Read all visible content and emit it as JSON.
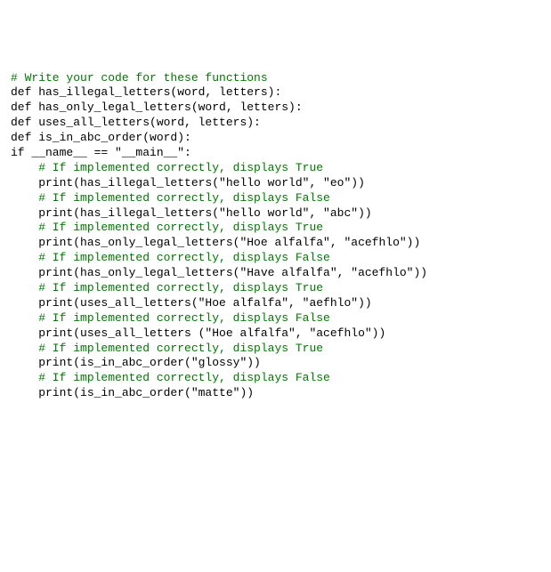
{
  "lines": [
    {
      "text": "# Write your code for these functions",
      "indent": 0,
      "style": "comment"
    },
    {
      "text": "def has_illegal_letters(word, letters):",
      "indent": 0,
      "style": "code"
    },
    {
      "text": "",
      "indent": 0,
      "style": "code"
    },
    {
      "text": "",
      "indent": 0,
      "style": "code"
    },
    {
      "text": "def has_only_legal_letters(word, letters):",
      "indent": 0,
      "style": "code"
    },
    {
      "text": "",
      "indent": 0,
      "style": "code"
    },
    {
      "text": "",
      "indent": 0,
      "style": "code"
    },
    {
      "text": "def uses_all_letters(word, letters):",
      "indent": 0,
      "style": "code"
    },
    {
      "text": "",
      "indent": 0,
      "style": "code"
    },
    {
      "text": "",
      "indent": 0,
      "style": "code"
    },
    {
      "text": "def is_in_abc_order(word):",
      "indent": 0,
      "style": "code"
    },
    {
      "text": "",
      "indent": 0,
      "style": "code"
    },
    {
      "text": "",
      "indent": 0,
      "style": "code"
    },
    {
      "text": "if __name__ == \"__main__\":",
      "indent": 0,
      "style": "code"
    },
    {
      "text": "# If implemented correctly, displays True",
      "indent": 4,
      "style": "comment"
    },
    {
      "text": "print(has_illegal_letters(\"hello world\", \"eo\"))",
      "indent": 4,
      "style": "code"
    },
    {
      "text": "",
      "indent": 0,
      "style": "code"
    },
    {
      "text": "# If implemented correctly, displays False",
      "indent": 4,
      "style": "comment"
    },
    {
      "text": "print(has_illegal_letters(\"hello world\", \"abc\"))",
      "indent": 4,
      "style": "code"
    },
    {
      "text": "",
      "indent": 0,
      "style": "code"
    },
    {
      "text": "# If implemented correctly, displays True",
      "indent": 4,
      "style": "comment"
    },
    {
      "text": "print(has_only_legal_letters(\"Hoe alfalfa\", \"acefhlo\"))",
      "indent": 4,
      "style": "code"
    },
    {
      "text": "",
      "indent": 0,
      "style": "code"
    },
    {
      "text": "# If implemented correctly, displays False",
      "indent": 4,
      "style": "comment"
    },
    {
      "text": "print(has_only_legal_letters(\"Have alfalfa\", \"acefhlo\"))",
      "indent": 4,
      "style": "code"
    },
    {
      "text": "",
      "indent": 0,
      "style": "code"
    },
    {
      "text": "# If implemented correctly, displays True",
      "indent": 4,
      "style": "comment"
    },
    {
      "text": "print(uses_all_letters(\"Hoe alfalfa\", \"aefhlo\"))",
      "indent": 4,
      "style": "code"
    },
    {
      "text": "",
      "indent": 0,
      "style": "code"
    },
    {
      "text": "# If implemented correctly, displays False",
      "indent": 4,
      "style": "comment"
    },
    {
      "text": "print(uses_all_letters (\"Hoe alfalfa\", \"acefhlo\"))",
      "indent": 4,
      "style": "code"
    },
    {
      "text": "",
      "indent": 0,
      "style": "code"
    },
    {
      "text": "# If implemented correctly, displays True",
      "indent": 4,
      "style": "comment"
    },
    {
      "text": "print(is_in_abc_order(\"glossy\"))",
      "indent": 4,
      "style": "code"
    },
    {
      "text": "",
      "indent": 0,
      "style": "code"
    },
    {
      "text": "# If implemented correctly, displays False",
      "indent": 4,
      "style": "comment"
    },
    {
      "text": "print(is_in_abc_order(\"matte\"))",
      "indent": 4,
      "style": "code"
    }
  ]
}
